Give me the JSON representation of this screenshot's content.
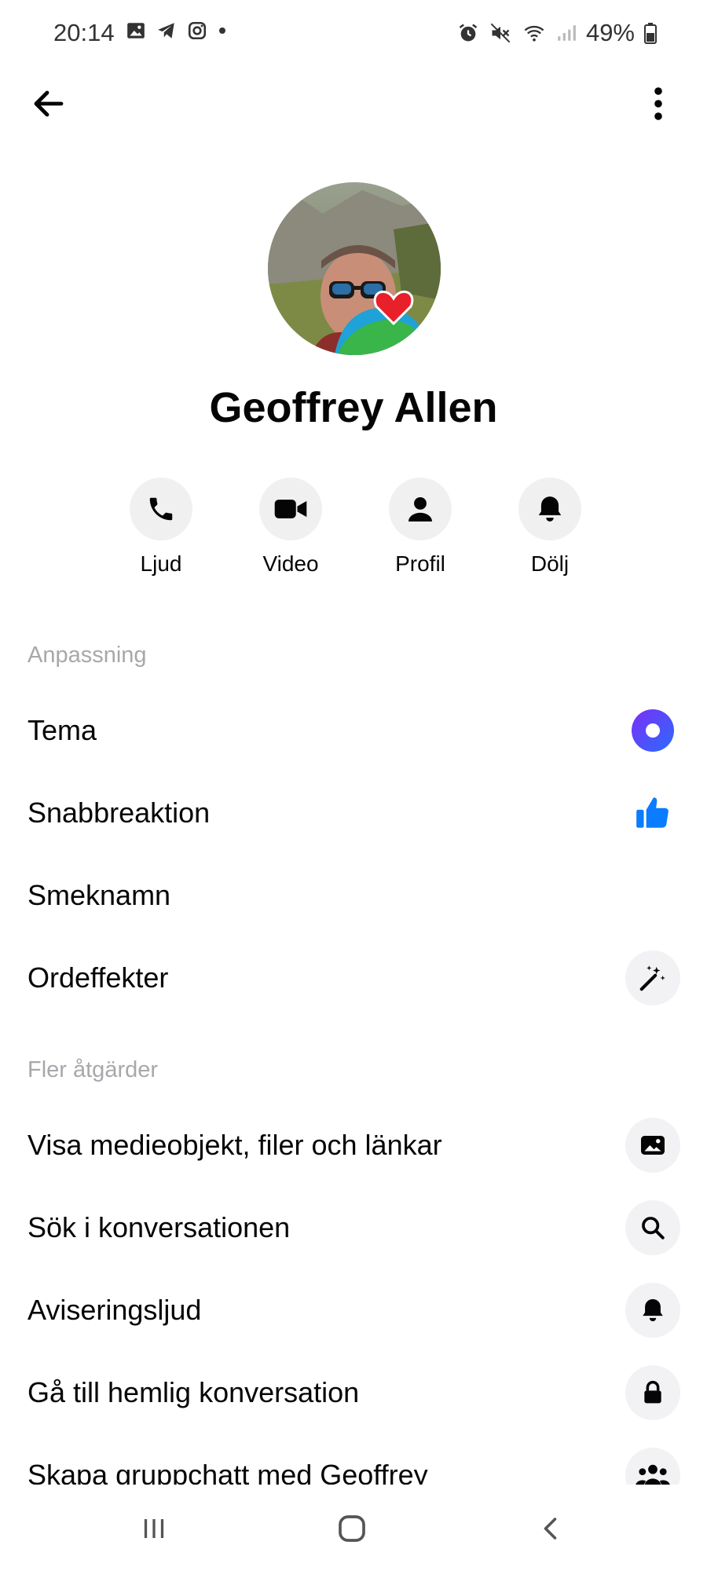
{
  "status_bar": {
    "time": "20:14",
    "battery": "49%",
    "left_icons": [
      "image-icon",
      "telegram-icon",
      "instagram-icon",
      "dot-icon"
    ],
    "right_icons": [
      "alarm-icon",
      "mute-icon",
      "wifi-icon",
      "signal-icon",
      "battery-icon"
    ]
  },
  "contact": {
    "name": "Geoffrey Allen"
  },
  "actions": [
    {
      "label": "Ljud",
      "icon": "phone-icon"
    },
    {
      "label": "Video",
      "icon": "video-icon"
    },
    {
      "label": "Profil",
      "icon": "person-icon"
    },
    {
      "label": "Dölj",
      "icon": "bell-icon"
    }
  ],
  "sections": {
    "customization": "Anpassning",
    "more_actions": "Fler åtgärder"
  },
  "customization_items": [
    {
      "label": "Tema",
      "icon": "theme-icon"
    },
    {
      "label": "Snabbreaktion",
      "icon": "thumbs-up-icon"
    },
    {
      "label": "Smeknamn",
      "icon": ""
    },
    {
      "label": "Ordeffekter",
      "icon": "magic-wand-icon"
    }
  ],
  "more_items": [
    {
      "label": "Visa medieobjekt, filer och länkar",
      "icon": "photo-icon"
    },
    {
      "label": "Sök i konversationen",
      "icon": "search-icon"
    },
    {
      "label": "Aviseringsljud",
      "icon": "bell-icon"
    },
    {
      "label": "Gå till hemlig konversation",
      "icon": "lock-icon"
    },
    {
      "label": "Skapa gruppchatt med Geoffrey",
      "icon": "group-icon"
    }
  ],
  "colors": {
    "accent_blue": "#0a7cff",
    "theme_gradient_start": "#7b2ff7",
    "theme_gradient_end": "#2a6bff",
    "section_gray": "#a8a8ac"
  }
}
